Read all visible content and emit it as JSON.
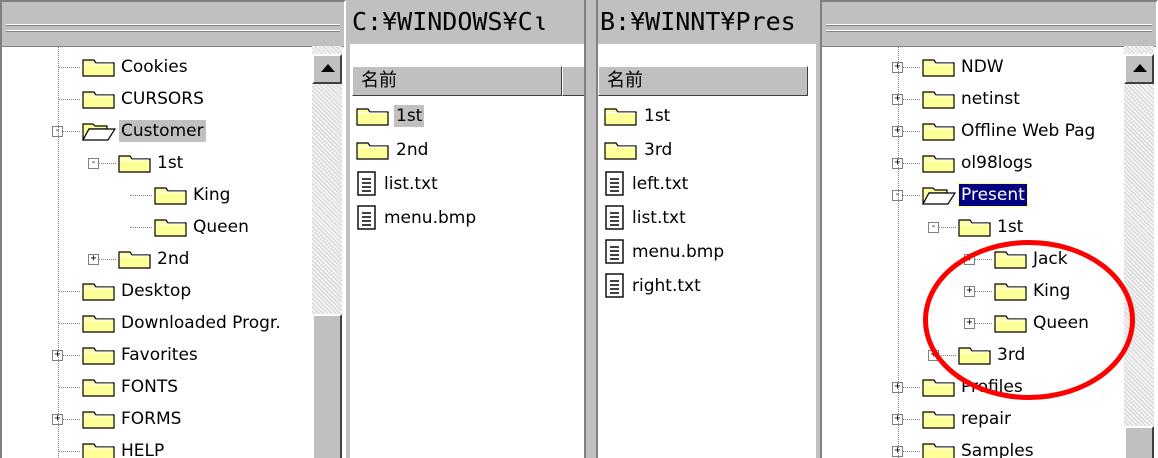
{
  "left_tree": {
    "items": [
      {
        "label": "Cookies",
        "depth": 0,
        "expander": "",
        "open": false
      },
      {
        "label": "CURSORS",
        "depth": 0,
        "expander": "",
        "open": false
      },
      {
        "label": "Customer",
        "depth": 0,
        "expander": "-",
        "open": true,
        "highlight": true
      },
      {
        "label": "1st",
        "depth": 1,
        "expander": "-",
        "open": false
      },
      {
        "label": "King",
        "depth": 2,
        "expander": "",
        "open": false
      },
      {
        "label": "Queen",
        "depth": 2,
        "expander": "",
        "open": false
      },
      {
        "label": "2nd",
        "depth": 1,
        "expander": "+",
        "open": false
      },
      {
        "label": "Desktop",
        "depth": 0,
        "expander": "",
        "open": false
      },
      {
        "label": "Downloaded Progr.",
        "depth": 0,
        "expander": "",
        "open": false
      },
      {
        "label": "Favorites",
        "depth": 0,
        "expander": "+",
        "open": false
      },
      {
        "label": "FONTS",
        "depth": 0,
        "expander": "",
        "open": false
      },
      {
        "label": "FORMS",
        "depth": 0,
        "expander": "+",
        "open": false
      },
      {
        "label": "HELP",
        "depth": 0,
        "expander": "",
        "open": false
      }
    ]
  },
  "middle_list": {
    "path": "C:¥WINDOWS¥Cι",
    "column_header": "名前",
    "items": [
      {
        "label": "1st",
        "icon": "folder-icon",
        "highlight": true
      },
      {
        "label": "2nd",
        "icon": "folder-icon",
        "highlight": false
      },
      {
        "label": "list.txt",
        "icon": "text-file-icon",
        "highlight": false
      },
      {
        "label": "menu.bmp",
        "icon": "text-file-icon",
        "highlight": false
      }
    ]
  },
  "right_list": {
    "path": "B:¥WINNT¥Pres",
    "column_header": "名前",
    "items": [
      {
        "label": "1st",
        "icon": "folder-icon"
      },
      {
        "label": "3rd",
        "icon": "folder-icon"
      },
      {
        "label": "left.txt",
        "icon": "text-file-icon"
      },
      {
        "label": "list.txt",
        "icon": "text-file-icon"
      },
      {
        "label": "menu.bmp",
        "icon": "text-file-icon"
      },
      {
        "label": "right.txt",
        "icon": "text-file-icon"
      }
    ]
  },
  "right_tree": {
    "items": [
      {
        "label": "NDW",
        "depth": 0,
        "expander": "+",
        "open": false
      },
      {
        "label": "netinst",
        "depth": 0,
        "expander": "+",
        "open": false
      },
      {
        "label": "Offline Web Pag",
        "depth": 0,
        "expander": "+",
        "open": false
      },
      {
        "label": "ol98logs",
        "depth": 0,
        "expander": "+",
        "open": false
      },
      {
        "label": "Present",
        "depth": 0,
        "expander": "-",
        "open": true,
        "selected": true
      },
      {
        "label": "1st",
        "depth": 1,
        "expander": "-",
        "open": false
      },
      {
        "label": "Jack",
        "depth": 2,
        "expander": "+",
        "open": false
      },
      {
        "label": "King",
        "depth": 2,
        "expander": "+",
        "open": false
      },
      {
        "label": "Queen",
        "depth": 2,
        "expander": "+",
        "open": false
      },
      {
        "label": "3rd",
        "depth": 1,
        "expander": "+",
        "open": false
      },
      {
        "label": "Profiles",
        "depth": 0,
        "expander": "+",
        "open": false
      },
      {
        "label": "repair",
        "depth": 0,
        "expander": "+",
        "open": false
      },
      {
        "label": "Samples",
        "depth": 0,
        "expander": "+",
        "open": false
      }
    ]
  },
  "colors": {
    "window_face": "#c0c0c0",
    "selection": "#000080",
    "annotation_circle": "#ff0000",
    "folder": "#ffff99"
  }
}
